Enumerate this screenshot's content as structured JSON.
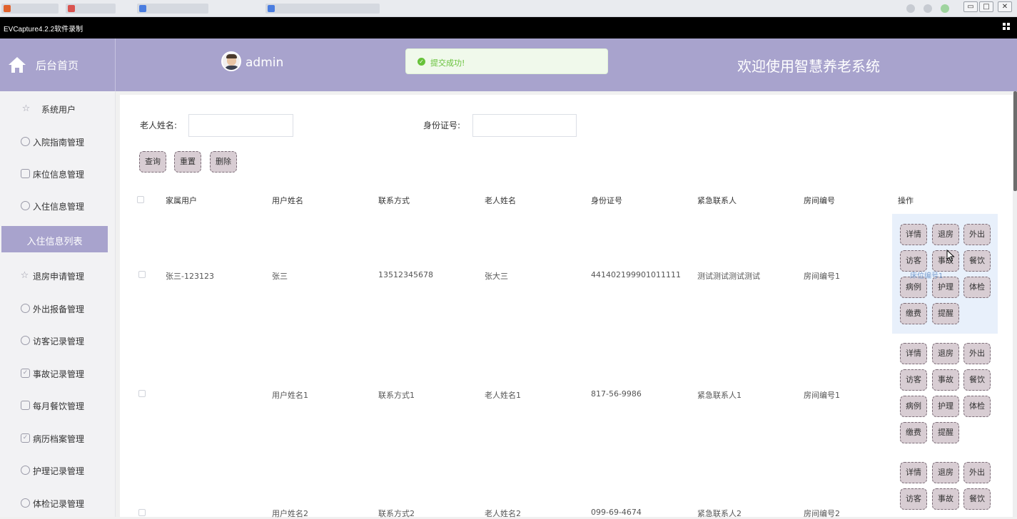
{
  "recorder": {
    "title": "EVCapture4.2.2软件录制"
  },
  "header": {
    "home_label": "后台首页",
    "user_name": "admin",
    "toast_message": "提交成功!",
    "welcome": "欢迎使用智慧养老系统",
    "bg_color": "#a8a3cd"
  },
  "sidebar": {
    "items": [
      {
        "label": "系统用户",
        "icon": "star-icon"
      },
      {
        "label": "入院指南管理",
        "icon": "clock-icon"
      },
      {
        "label": "床位信息管理",
        "icon": "calendar-icon"
      },
      {
        "label": "入住信息管理",
        "icon": "refresh-icon"
      },
      {
        "label": "入住信息列表",
        "icon": "",
        "active": true
      },
      {
        "label": "退房申请管理",
        "icon": "star-icon"
      },
      {
        "label": "外出报备管理",
        "icon": "compass-icon"
      },
      {
        "label": "访客记录管理",
        "icon": "clock-icon"
      },
      {
        "label": "事故记录管理",
        "icon": "check-calendar-icon"
      },
      {
        "label": "每月餐饮管理",
        "icon": "calendar-icon"
      },
      {
        "label": "病历档案管理",
        "icon": "check-calendar-icon"
      },
      {
        "label": "护理记录管理",
        "icon": "refresh-icon"
      },
      {
        "label": "体检记录管理",
        "icon": "clock-icon"
      }
    ]
  },
  "filters": {
    "elder_name_label": "老人姓名:",
    "elder_name_value": "",
    "id_number_label": "身份证号:",
    "id_number_value": ""
  },
  "toolbar": {
    "query": "查询",
    "reset": "重置",
    "delete": "删除"
  },
  "table": {
    "columns": [
      "家属用户",
      "用户姓名",
      "联系方式",
      "老人姓名",
      "身份证号",
      "紧急联系人",
      "房间编号",
      "操作"
    ],
    "rows": [
      {
        "family_user": "张三-123123",
        "user_name": "张三",
        "contact": "13512345678",
        "elder_name": "张大三",
        "id_number": "441402199901011111",
        "emergency_contact": "测试测试测试测试",
        "room": "房间编号1"
      },
      {
        "family_user": "",
        "user_name": "用户姓名1",
        "contact": "联系方式1",
        "elder_name": "老人姓名1",
        "id_number": "817-56-9986",
        "emergency_contact": "紧急联系人1",
        "room": "房间编号1"
      },
      {
        "family_user": "",
        "user_name": "用户姓名2",
        "contact": "联系方式2",
        "elder_name": "老人姓名2",
        "id_number": "099-69-4674",
        "emergency_contact": "紧急联系人2",
        "room": "房间编号2"
      }
    ],
    "row_actions": [
      "详情",
      "退房",
      "外出",
      "访客",
      "事故",
      "餐饮",
      "病例",
      "护理",
      "体检",
      "缴费",
      "提醒"
    ],
    "overlay_text": "床位编号1"
  }
}
